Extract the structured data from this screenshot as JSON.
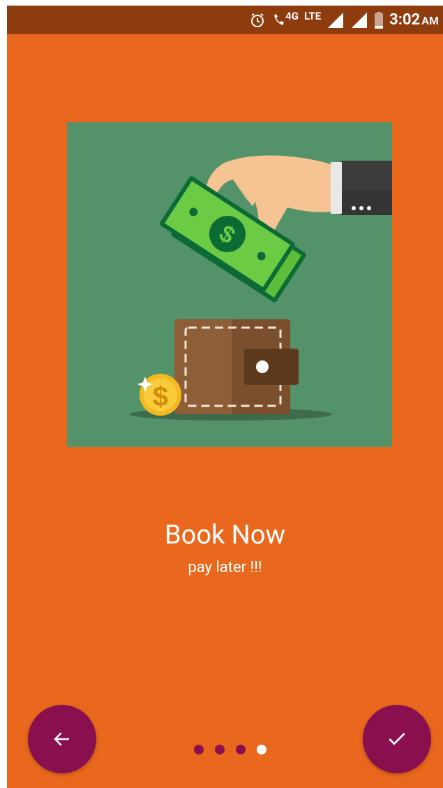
{
  "status_bar": {
    "network_label": "LTE",
    "network_sub": "4G",
    "time": "3:02",
    "ampm": "AM"
  },
  "onboarding": {
    "title": "Book Now",
    "subtitle": "pay later !!!",
    "illustration": {
      "desc_icons": [
        "hand-with-money-icon",
        "wallet-icon",
        "dollar-coin-icon"
      ]
    }
  },
  "navigation": {
    "back_icon": "arrow-left-icon",
    "done_icon": "check-icon",
    "page_indicator": {
      "total": 4,
      "current": 4
    }
  },
  "colors": {
    "background": "#EA681D",
    "status_bar": "#8E3B0E",
    "illustration_bg": "#54936A",
    "fab": "#8A0F4F"
  }
}
